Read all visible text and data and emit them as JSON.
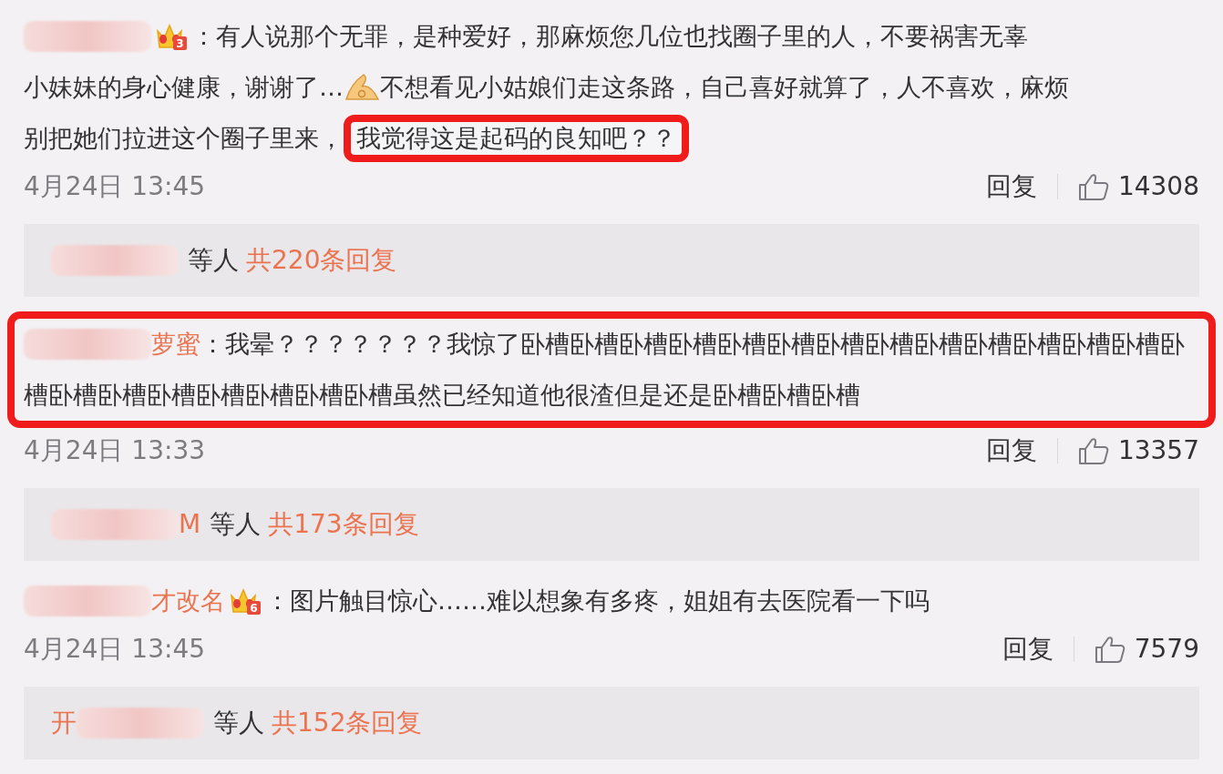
{
  "comments": [
    {
      "author": [
        {
          "kind": "redacted"
        }
      ],
      "vip_level": "3",
      "highlighted": false,
      "lines": [
        [
          {
            "kind": "text",
            "text": "：有人说那个无罪，是种爱好，那麻烦您几位也找圈子里的人，不要祸害无辜",
            "highlighted": false
          }
        ],
        [
          {
            "kind": "text",
            "text": "小妹妹的身心健康，谢谢了…",
            "highlighted": false
          },
          {
            "kind": "emoji"
          },
          {
            "kind": "text",
            "text": "不想看见小姑娘们走这条路，自己喜好就算了，人不喜欢，麻烦",
            "highlighted": false
          }
        ],
        [
          {
            "kind": "text",
            "text": "别把她们拉进这个圈子里来，",
            "highlighted": false
          },
          {
            "kind": "text",
            "text": "我觉得这是起码的良知吧？？",
            "highlighted": true
          }
        ]
      ],
      "time": "4月24日 13:45",
      "reply_label": "回复",
      "likes": "14308",
      "reply_summary": {
        "name_parts": [
          {
            "kind": "redacted"
          }
        ],
        "others_label": "等人",
        "count_label": "共220条回复"
      }
    },
    {
      "author": [
        {
          "kind": "redacted"
        },
        {
          "kind": "text",
          "text": "萝蜜"
        }
      ],
      "highlighted": true,
      "lines": [
        [
          {
            "kind": "text",
            "text": "：我晕？？？？？？？我惊了卧槽卧槽卧槽卧槽卧槽卧槽卧槽卧槽卧槽卧槽卧槽卧槽卧槽卧",
            "highlighted": false
          }
        ],
        [
          {
            "kind": "text",
            "text": "槽卧槽卧槽卧槽卧槽卧槽卧槽卧槽虽然已经知道他很渣但是还是卧槽卧槽卧槽",
            "highlighted": false
          }
        ]
      ],
      "time": "4月24日 13:33",
      "reply_label": "回复",
      "likes": "13357",
      "reply_summary": {
        "name_parts": [
          {
            "kind": "redacted"
          },
          {
            "kind": "text",
            "text": "M"
          }
        ],
        "others_label": "等人",
        "count_label": "共173条回复"
      }
    },
    {
      "author": [
        {
          "kind": "redacted"
        },
        {
          "kind": "text",
          "text": "才改名"
        }
      ],
      "vip_level": "6",
      "highlighted": false,
      "lines": [
        [
          {
            "kind": "text",
            "text": "：图片触目惊心……难以想象有多疼，姐姐有去医院看一下吗",
            "highlighted": false
          }
        ]
      ],
      "time": "4月24日 13:45",
      "reply_label": "回复",
      "likes": "7579",
      "reply_summary": {
        "name_parts": [
          {
            "kind": "text",
            "text": "开"
          },
          {
            "kind": "redacted"
          }
        ],
        "others_label": "等人",
        "count_label": "共152条回复"
      }
    }
  ]
}
